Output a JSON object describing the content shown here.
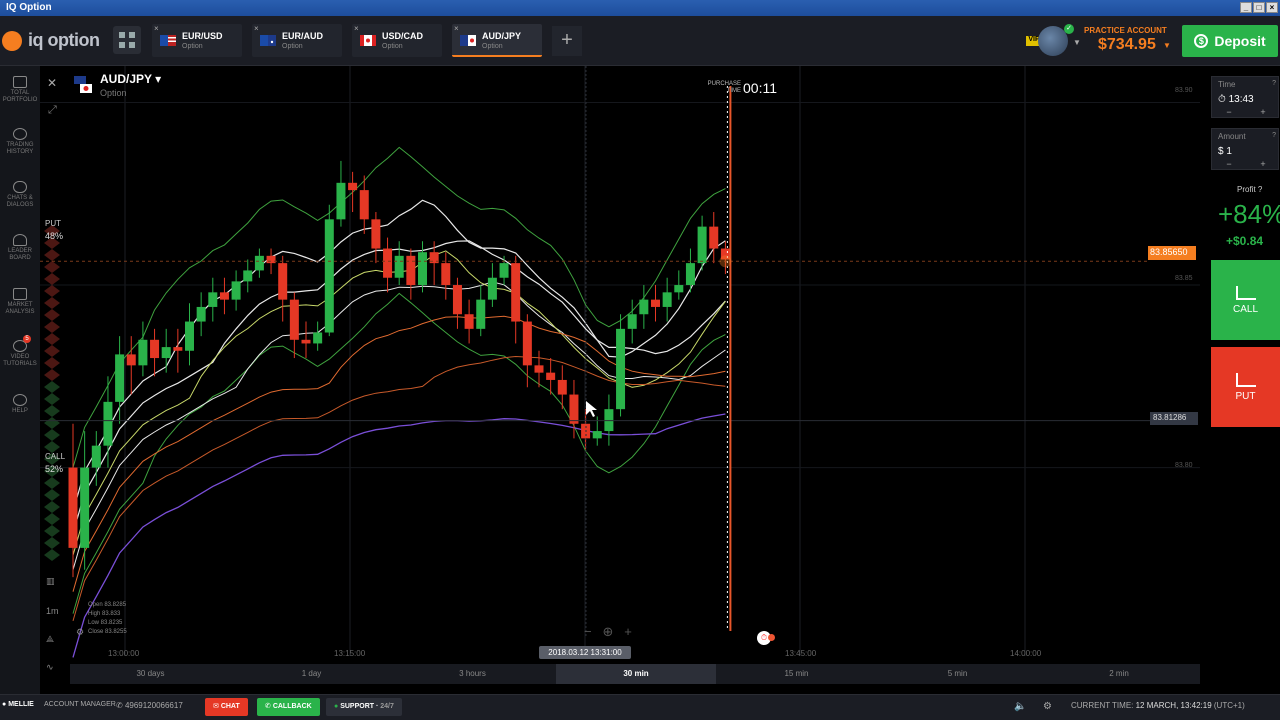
{
  "window": {
    "title": "IQ Option"
  },
  "brand": {
    "name": "iq option"
  },
  "tabs": [
    {
      "pair": "EUR/USD",
      "type": "Option"
    },
    {
      "pair": "EUR/AUD",
      "type": "Option"
    },
    {
      "pair": "USD/CAD",
      "type": "Option"
    },
    {
      "pair": "AUD/JPY",
      "type": "Option"
    }
  ],
  "account": {
    "badge": "VIP",
    "label": "PRACTICE ACCOUNT",
    "balance": "$734.95",
    "deposit_label": "Deposit"
  },
  "sidebar": [
    {
      "label1": "TOTAL",
      "label2": "PORTFOLIO"
    },
    {
      "label1": "TRADING",
      "label2": "HISTORY"
    },
    {
      "label1": "CHATS &",
      "label2": "DIALOGS"
    },
    {
      "label1": "LEADER",
      "label2": "BOARD"
    },
    {
      "label1": "MARKET",
      "label2": "ANALYSIS"
    },
    {
      "label1": "VIDEO",
      "label2": "TUTORIALS",
      "badge": "5"
    },
    {
      "label1": "HELP",
      "label2": ""
    }
  ],
  "chart": {
    "pair": "AUD/JPY",
    "type": "Option",
    "purchase_label": "PURCHASE TIME",
    "purchase_time": "00:11",
    "put_label": "PUT",
    "put_pct": "48%",
    "call_label": "CALL",
    "call_pct": "52%",
    "current_price": "83.85650",
    "level_price": "83.81286",
    "crosshair_time": "2018.03.12 13:31:00",
    "ohlc": {
      "open": "Open 83.8285",
      "high": "High 83.833",
      "low": "Low 83.8235",
      "close": "Close 83.8255"
    },
    "x_ticks": [
      "13:00:00",
      "13:15:00",
      "13:45:00",
      "14:00:00"
    ],
    "y_ticks": [
      "83.90",
      "83.85",
      "83.80"
    ],
    "tool_1m": "1m"
  },
  "chart_data": {
    "type": "candlestick",
    "x_ticks": [
      "13:00:00",
      "13:15:00",
      "13:45:00",
      "14:00:00"
    ],
    "y_ticks": [
      83.9,
      83.85,
      83.8
    ],
    "ylim": [
      83.75,
      83.91
    ],
    "current_price": 83.8565,
    "level": 83.81286,
    "candle_colors": {
      "up": "#2ab34a",
      "down": "#e53825"
    },
    "candles": [
      [
        83.8,
        83.778,
        83.77,
        83.812
      ],
      [
        83.778,
        83.8,
        83.772,
        83.81
      ],
      [
        83.8,
        83.806,
        83.795,
        83.81
      ],
      [
        83.806,
        83.818,
        83.8,
        83.825
      ],
      [
        83.818,
        83.831,
        83.812,
        83.836
      ],
      [
        83.831,
        83.828,
        83.82,
        83.836
      ],
      [
        83.828,
        83.835,
        83.825,
        83.84
      ],
      [
        83.835,
        83.83,
        83.825,
        83.838
      ],
      [
        83.83,
        83.833,
        83.826,
        83.838
      ],
      [
        83.833,
        83.832,
        83.826,
        83.838
      ],
      [
        83.832,
        83.84,
        83.828,
        83.845
      ],
      [
        83.84,
        83.844,
        83.836,
        83.848
      ],
      [
        83.844,
        83.848,
        83.84,
        83.852
      ],
      [
        83.848,
        83.846,
        83.842,
        83.852
      ],
      [
        83.846,
        83.851,
        83.843,
        83.854
      ],
      [
        83.851,
        83.854,
        83.848,
        83.857
      ],
      [
        83.854,
        83.858,
        83.852,
        83.86
      ],
      [
        83.858,
        83.856,
        83.853,
        83.86
      ],
      [
        83.856,
        83.846,
        83.84,
        83.858
      ],
      [
        83.846,
        83.835,
        83.83,
        83.848
      ],
      [
        83.835,
        83.834,
        83.83,
        83.84
      ],
      [
        83.834,
        83.837,
        83.832,
        83.84
      ],
      [
        83.837,
        83.868,
        83.836,
        83.872
      ],
      [
        83.868,
        83.878,
        83.866,
        83.884
      ],
      [
        83.878,
        83.876,
        83.87,
        83.881
      ],
      [
        83.876,
        83.868,
        83.864,
        83.88
      ],
      [
        83.868,
        83.86,
        83.856,
        83.87
      ],
      [
        83.86,
        83.852,
        83.848,
        83.863
      ],
      [
        83.852,
        83.858,
        83.85,
        83.862
      ],
      [
        83.858,
        83.85,
        83.846,
        83.86
      ],
      [
        83.85,
        83.859,
        83.848,
        83.862
      ],
      [
        83.859,
        83.856,
        83.85,
        83.862
      ],
      [
        83.856,
        83.85,
        83.846,
        83.859
      ],
      [
        83.85,
        83.842,
        83.838,
        83.852
      ],
      [
        83.842,
        83.838,
        83.834,
        83.846
      ],
      [
        83.838,
        83.846,
        83.836,
        83.85
      ],
      [
        83.846,
        83.852,
        83.844,
        83.856
      ],
      [
        83.852,
        83.856,
        83.85,
        83.858
      ],
      [
        83.856,
        83.84,
        83.834,
        83.858
      ],
      [
        83.84,
        83.828,
        83.822,
        83.842
      ],
      [
        83.828,
        83.826,
        83.822,
        83.832
      ],
      [
        83.826,
        83.824,
        83.82,
        83.83
      ],
      [
        83.824,
        83.82,
        83.816,
        83.828
      ],
      [
        83.82,
        83.812,
        83.808,
        83.824
      ],
      [
        83.812,
        83.808,
        83.805,
        83.816
      ],
      [
        83.808,
        83.81,
        83.806,
        83.814
      ],
      [
        83.81,
        83.816,
        83.806,
        83.82
      ],
      [
        83.816,
        83.838,
        83.814,
        83.842
      ],
      [
        83.838,
        83.842,
        83.834,
        83.846
      ],
      [
        83.842,
        83.846,
        83.838,
        83.85
      ],
      [
        83.846,
        83.844,
        83.84,
        83.85
      ],
      [
        83.844,
        83.848,
        83.84,
        83.852
      ],
      [
        83.848,
        83.85,
        83.846,
        83.854
      ],
      [
        83.85,
        83.856,
        83.848,
        83.86
      ],
      [
        83.856,
        83.866,
        83.854,
        83.869
      ],
      [
        83.866,
        83.86,
        83.856,
        83.87
      ],
      [
        83.86,
        83.857,
        83.853,
        83.862
      ]
    ]
  },
  "panel": {
    "time_label": "Time",
    "time_value": "13:43",
    "amount_label": "Amount",
    "amount_value": "$ 1",
    "profit_label": "Profit",
    "profit_pct": "+84%",
    "profit_amt": "+$0.84",
    "call_label": "CALL",
    "put_label": "PUT"
  },
  "periods": [
    "30 days",
    "1 day",
    "3 hours",
    "30 min",
    "15 min",
    "5 min",
    "2 min"
  ],
  "footer": {
    "user": "MELLIE",
    "manager": "ACCOUNT MANAGER",
    "phone": "4969120066617",
    "chat": "CHAT",
    "callback": "CALLBACK",
    "support": "SUPPORT",
    "support_hours": "24/7",
    "time_label": "CURRENT TIME:",
    "time_value": "12 MARCH, 13:42:19",
    "tz": "(UTC+1)"
  }
}
